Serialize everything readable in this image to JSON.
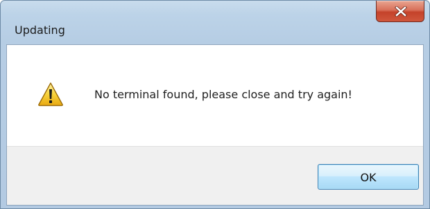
{
  "window": {
    "title": "Updating",
    "close_icon": "close-x-icon",
    "close_color": "#c94a31"
  },
  "dialog": {
    "icon": "warning-icon",
    "message": "No terminal found, please close and try again!"
  },
  "buttons": {
    "ok_label": "OK"
  }
}
